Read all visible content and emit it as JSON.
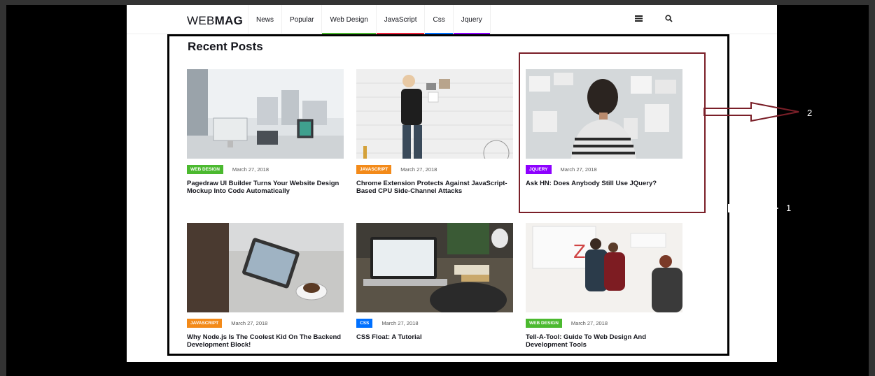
{
  "header": {
    "logo_light": "WEB",
    "logo_bold": "MAG",
    "nav": [
      {
        "label": "News",
        "color": ""
      },
      {
        "label": "Popular",
        "color": ""
      },
      {
        "label": "Web Design",
        "color": "#4bb92f"
      },
      {
        "label": "JavaScript",
        "color": "#ef233c"
      },
      {
        "label": "Css",
        "color": "#0070ff"
      },
      {
        "label": "Jquery",
        "color": "#8d00ff"
      }
    ],
    "menu_icon": "hamburger-icon",
    "search_icon": "search-icon"
  },
  "section": {
    "title": "Recent Posts"
  },
  "posts": [
    {
      "category": "WEB DESIGN",
      "category_color": "#4bb92f",
      "date": "March 27, 2018",
      "title": "Pagedraw UI Builder Turns Your Website Design Mockup Into Code Automatically"
    },
    {
      "category": "JAVASCRIPT",
      "category_color": "#f38a19",
      "date": "March 27, 2018",
      "title": "Chrome Extension Protects Against JavaScript-Based CPU Side-Channel Attacks"
    },
    {
      "category": "JQUERY",
      "category_color": "#8d00ff",
      "date": "March 27, 2018",
      "title": "Ask HN: Does Anybody Still Use JQuery?"
    },
    {
      "category": "JAVASCRIPT",
      "category_color": "#f38a19",
      "date": "March 27, 2018",
      "title": "Why Node.js Is The Coolest Kid On The Backend Development Block!"
    },
    {
      "category": "CSS",
      "category_color": "#0070ff",
      "date": "March 27, 2018",
      "title": "CSS Float: A Tutorial"
    },
    {
      "category": "WEB DESIGN",
      "category_color": "#4bb92f",
      "date": "March 27, 2018",
      "title": "Tell-A-Tool: Guide To Web Design And Development Tools"
    }
  ],
  "annotations": {
    "label_1": "1",
    "label_2": "2"
  }
}
